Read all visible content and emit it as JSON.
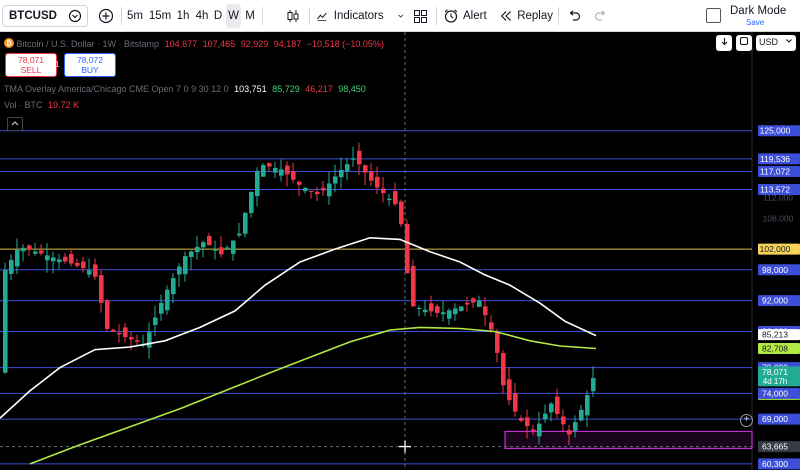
{
  "toolbar": {
    "symbol": "BTCUSD",
    "timeframes": [
      "5m",
      "15m",
      "1h",
      "4h",
      "D",
      "W",
      "M"
    ],
    "active_timeframe": "W",
    "indicators_label": "Indicators",
    "alert_label": "Alert",
    "replay_label": "Replay",
    "dark_mode_label": "Dark Mode",
    "dark_mode_sub": "Save"
  },
  "legend": {
    "title": "Bitcoin / U.S. Dollar · 1W · Bitstamp",
    "ohlc": {
      "o": "104,677",
      "h": "107,465",
      "l": "92,929",
      "c": "94,187",
      "chg": "−10,518 (−10.05%)"
    },
    "tma_label": "TMA Overlay America/Chicago CME Open 7 0 9 30 12 0",
    "tma_values": [
      "103,751",
      "85,729",
      "46,217",
      "98,450"
    ],
    "vol_label": "Vol · BTC",
    "vol_value": "19.72 K"
  },
  "trade": {
    "sell_price": "78,071",
    "sell_label": "SELL",
    "spread": "1",
    "buy_price": "78,072",
    "buy_label": "BUY"
  },
  "scale_controls": {
    "currency": "USD"
  },
  "axis_ticks_faded": [
    "112,000",
    "108,000"
  ],
  "price_labels": [
    {
      "text": "125,000",
      "kind": "level"
    },
    {
      "text": "119,536",
      "kind": "level"
    },
    {
      "text": "117,072",
      "kind": "level"
    },
    {
      "text": "113,572",
      "kind": "level"
    },
    {
      "text": "102,000",
      "kind": "yellow"
    },
    {
      "text": "98,000",
      "kind": "level"
    },
    {
      "text": "92,000",
      "kind": "level"
    },
    {
      "text": "86,000",
      "kind": "level"
    },
    {
      "text": "85,213",
      "kind": "white"
    },
    {
      "text": "82,708",
      "kind": "lime"
    },
    {
      "text": "79,000",
      "kind": "level"
    },
    {
      "text": "78,071",
      "sub": "4d 17h",
      "kind": "last"
    },
    {
      "text": "76,223",
      "kind": "lime"
    },
    {
      "text": "74,000",
      "kind": "level"
    },
    {
      "text": "69,000",
      "kind": "level"
    },
    {
      "text": "63,665",
      "kind": "crosshair"
    },
    {
      "text": "60,300",
      "kind": "level"
    }
  ],
  "colors": {
    "bull": "#22ab94",
    "bear": "#f23645",
    "level_line": "#3d4fd8",
    "yellow_line": "#d8c04a",
    "ma_white": "#ffffff",
    "ma_lime": "#b2e843",
    "zone": "#c32bd9"
  }
}
